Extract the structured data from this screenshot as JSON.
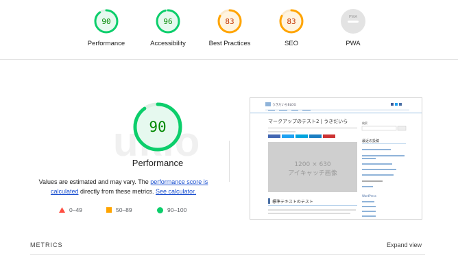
{
  "colors": {
    "pass": "#0cce6b",
    "average": "#ffa400",
    "fail": "#ff4e42",
    "na": "#9e9e9e"
  },
  "categories": [
    {
      "label": "Performance",
      "score": "90",
      "status": "pass"
    },
    {
      "label": "Accessibility",
      "score": "96",
      "status": "pass"
    },
    {
      "label": "Best Practices",
      "score": "83",
      "status": "average"
    },
    {
      "label": "SEO",
      "score": "83",
      "status": "average"
    },
    {
      "label": "PWA",
      "score": "",
      "status": "na",
      "badge_text": "PWA"
    }
  ],
  "main_gauge": {
    "score": "90",
    "label": "Performance",
    "progress_fraction": 0.9
  },
  "note": {
    "prefix": "Values are estimated and may vary. The ",
    "link1": "performance score is calculated",
    "middle": " directly from these metrics. ",
    "link2": "See calculator."
  },
  "legend": [
    {
      "range": "0–49",
      "shape": "triangle-icon",
      "status": "fail"
    },
    {
      "range": "50–89",
      "shape": "square-icon",
      "status": "average"
    },
    {
      "range": "90–100",
      "shape": "circle-icon",
      "status": "pass"
    }
  ],
  "screenshot": {
    "site_name": "うきだいらBLOG",
    "post_title": "マークアップのテスト2 | うきだいら",
    "placeholder_size": "1200 × 630",
    "placeholder_caption": "アイキャッチ画像",
    "section_heading": "標準テキストのテスト",
    "sidebar_heading": "最近の投稿",
    "sidebar_search": "検索",
    "sidebar_wordpress": "WordPress"
  },
  "watermark": "ukio",
  "metrics_label": "METRICS",
  "expand_label": "Expand view"
}
